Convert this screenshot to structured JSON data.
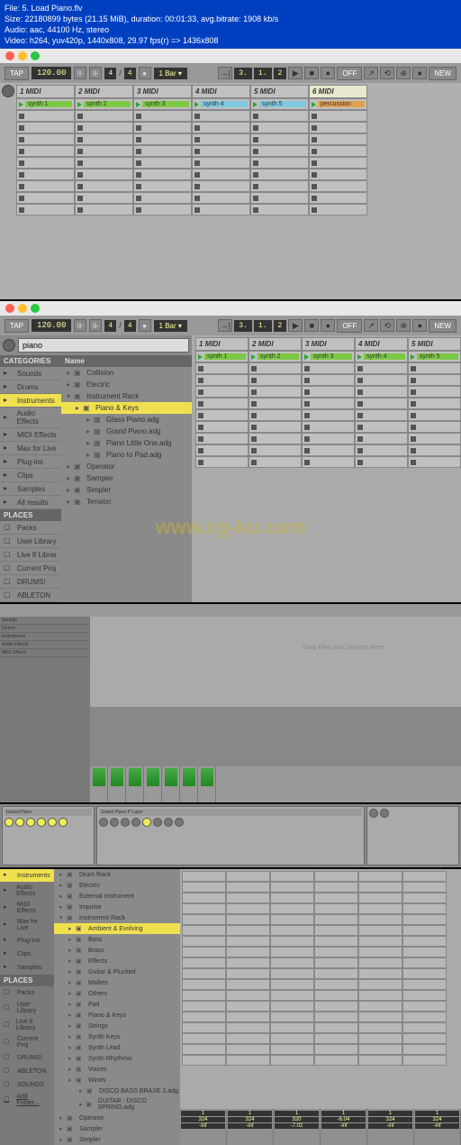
{
  "file_header": {
    "line1": "File: 5. Load Piano.flv",
    "line2": "Size: 22180899 bytes (21.15 MiB), duration: 00:01:33, avg.bitrate: 1908 kb/s",
    "line3": "Audio: aac, 44100 Hz, stereo",
    "line4": "Video: h264, yuv420p, 1440x808, 29.97 fps(r) => 1436x808"
  },
  "toolbar": {
    "tap": "TAP",
    "tempo": "120.00",
    "sig_num": "4",
    "sig_den": "4",
    "loop_label": "1 Bar ▾",
    "pos1": "3.",
    "pos2": "1.",
    "pos3": "2",
    "rec_off": "OFF",
    "new": "NEW"
  },
  "section1": {
    "tracks": [
      {
        "head": "1 MIDI",
        "clip": "synth 1",
        "color": "green"
      },
      {
        "head": "2 MIDI",
        "clip": "synth 2",
        "color": "green"
      },
      {
        "head": "3 MIDI",
        "clip": "synth 3",
        "color": "green"
      },
      {
        "head": "4 MIDI",
        "clip": "synth 4",
        "color": "blue"
      },
      {
        "head": "5 MIDI",
        "clip": "synth 5",
        "color": "blue"
      },
      {
        "head": "6 MIDI",
        "clip": "percussion",
        "color": "orange",
        "selected": true
      }
    ]
  },
  "section2": {
    "search_value": "piano",
    "cat_header_1": "CATEGORIES",
    "cat_header_2": "Name",
    "categories": [
      "Sounds",
      "Drums",
      "Instruments",
      "Audio Effects",
      "MIDI Effects",
      "Max for Live",
      "Plug-ins",
      "Clips",
      "Samples",
      "All results"
    ],
    "tree": [
      {
        "label": "Collision",
        "indent": 0
      },
      {
        "label": "Electric",
        "indent": 0
      },
      {
        "label": "Instrument Rack",
        "indent": 0,
        "expanded": true
      },
      {
        "label": "Piano & Keys",
        "indent": 1,
        "hl": true
      },
      {
        "label": "Glass Piano.adg",
        "indent": 2
      },
      {
        "label": "Grand Piano.adg",
        "indent": 2
      },
      {
        "label": "Piano Little One.adg",
        "indent": 2
      },
      {
        "label": "Piano to Pad.adg",
        "indent": 2
      },
      {
        "label": "Operator",
        "indent": 0
      },
      {
        "label": "Sampler",
        "indent": 0
      },
      {
        "label": "Simpler",
        "indent": 0
      },
      {
        "label": "Tension",
        "indent": 0
      }
    ],
    "places_header": "PLACES",
    "places": [
      "Packs",
      "User Library",
      "Live 8 Librar",
      "Current Proj",
      "DRUMS!",
      "ABLETON"
    ],
    "tracks": [
      {
        "head": "1 MIDI",
        "clip": "synth 1"
      },
      {
        "head": "2 MIDI",
        "clip": "synth 2"
      },
      {
        "head": "3 MIDI",
        "clip": "synth 3"
      },
      {
        "head": "4 MIDI",
        "clip": "synth 4"
      },
      {
        "head": "5 MIDI",
        "clip": "synth 5"
      }
    ]
  },
  "watermark": "www.cg-ku.com",
  "section3": {
    "drop_text": "Drop Files and Devices Here"
  },
  "section5": {
    "categories": [
      "Instruments",
      "Audio Effects",
      "MIDI Effects",
      "Max for Live",
      "Plug-ins",
      "Clips",
      "Samples"
    ],
    "tree": [
      {
        "label": "Drum Rack",
        "indent": 0
      },
      {
        "label": "Electric",
        "indent": 0
      },
      {
        "label": "External Instrument",
        "indent": 0
      },
      {
        "label": "Impulse",
        "indent": 0
      },
      {
        "label": "Instrument Rack",
        "indent": 0,
        "expanded": true
      },
      {
        "label": "Ambient & Evolving",
        "indent": 1,
        "hl": true
      },
      {
        "label": "Bass",
        "indent": 1
      },
      {
        "label": "Brass",
        "indent": 1
      },
      {
        "label": "Effects",
        "indent": 1
      },
      {
        "label": "Guitar & Plucked",
        "indent": 1
      },
      {
        "label": "Mallets",
        "indent": 1
      },
      {
        "label": "Others",
        "indent": 1
      },
      {
        "label": "Pad",
        "indent": 1
      },
      {
        "label": "Piano & Keys",
        "indent": 1
      },
      {
        "label": "Strings",
        "indent": 1
      },
      {
        "label": "Synth Keys",
        "indent": 1
      },
      {
        "label": "Synth Lead",
        "indent": 1
      },
      {
        "label": "Synth Rhythmic",
        "indent": 1
      },
      {
        "label": "Voices",
        "indent": 1
      },
      {
        "label": "Winds",
        "indent": 1
      },
      {
        "label": "DISCO BASS BRAXE 2.adg",
        "indent": 2
      },
      {
        "label": "GUITAR - DISCO SPRING.adg",
        "indent": 2
      },
      {
        "label": "Operator",
        "indent": 0
      },
      {
        "label": "Sampler",
        "indent": 0
      },
      {
        "label": "Simpler",
        "indent": 0
      }
    ],
    "places_header": "PLACES",
    "places": [
      "Packs",
      "User Library",
      "Live 8 Library",
      "Current Proj",
      "DRUMS!",
      "ABLETON",
      "SOUNDS",
      "Add Folder..."
    ],
    "mixer": {
      "sends": [
        "1",
        "1",
        "1",
        "1",
        "1",
        "1"
      ],
      "vals": [
        "324",
        "324",
        "320",
        "-6.04",
        "324",
        "324"
      ],
      "inf": [
        "-inf",
        "-inf",
        "-7.02",
        "-inf",
        "-inf",
        "-inf"
      ]
    }
  }
}
